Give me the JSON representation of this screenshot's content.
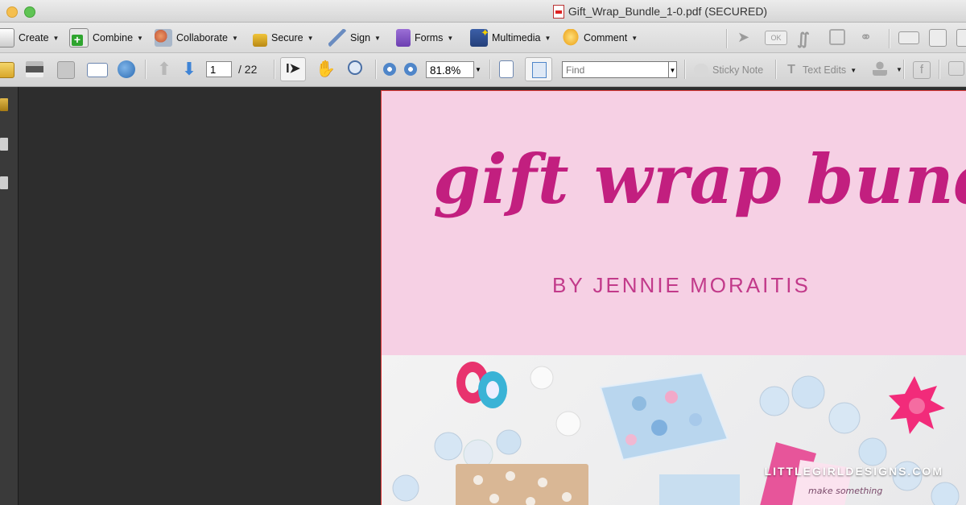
{
  "window": {
    "title": "Gift_Wrap_Bundle_1-0.pdf (SECURED)"
  },
  "toolbar1": {
    "create": "Create",
    "combine": "Combine",
    "collaborate": "Collaborate",
    "secure": "Secure",
    "sign": "Sign",
    "forms": "Forms",
    "multimedia": "Multimedia",
    "comment": "Comment",
    "ok_label": "OK"
  },
  "toolbar2": {
    "current_page": "1",
    "page_total": "/ 22",
    "zoom": "81.8%",
    "find_placeholder": "Find",
    "sticky_note": "Sticky Note",
    "text_edits": "Text Edits"
  },
  "document": {
    "headline": "gift wrap bundle",
    "byline": "BY JENNIE MORAITIS",
    "site_url": "LITTLEGIRLDESIGNS.COM",
    "photo_text": "make something"
  },
  "colors": {
    "page_bg": "#f6d0e4",
    "headline": "#c21f7f",
    "viewer_bg": "#2d2d2d",
    "page_border": "#e23a3a"
  }
}
